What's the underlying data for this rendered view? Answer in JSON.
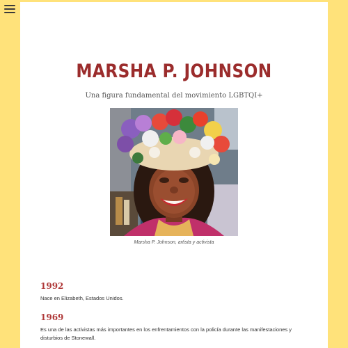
{
  "header": {
    "menu_icon": "hamburger-menu-icon"
  },
  "profile": {
    "title": "MARSHA P. JOHNSON",
    "subtitle": "Una figura fundamental del movimiento LGBTQI+",
    "image_caption": "Marsha P. Johnson, artista y activista"
  },
  "timeline": [
    {
      "year": "1992",
      "description": "Nace en Elizabeth, Estados Unidos."
    },
    {
      "year": "1969",
      "description": "Es una de las activistas más importantes en los enfrentamientos con la policía durante las manifestaciones y disturbios de Stonewall."
    }
  ],
  "colors": {
    "background": "#ffe27a",
    "card": "#ffffff",
    "title": "#9b2c2c",
    "year": "#b03a3a"
  }
}
